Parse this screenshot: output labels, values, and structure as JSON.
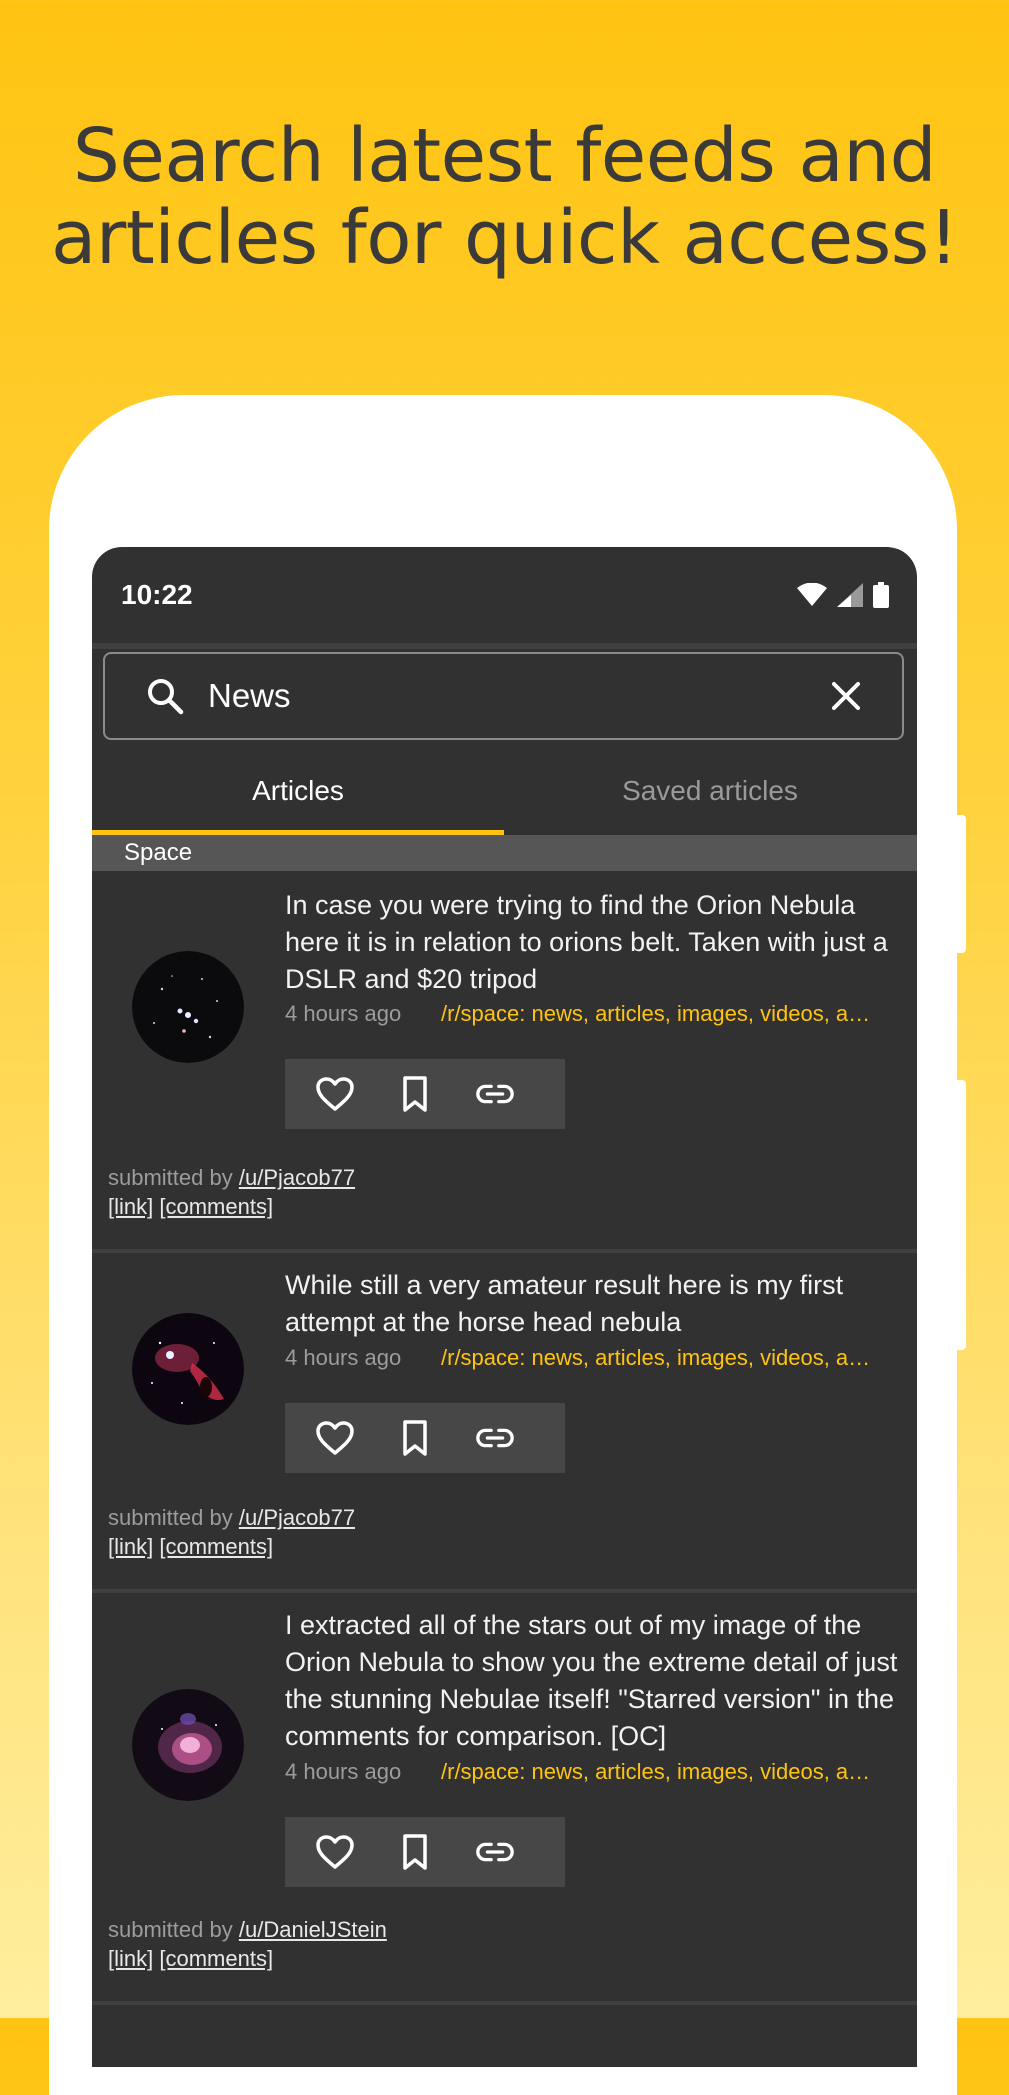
{
  "headline": {
    "line1": "Search latest feeds and",
    "line2": "articles for quick access!"
  },
  "status_bar": {
    "time": "10:22",
    "icons": [
      "wifi-icon",
      "signal-icon",
      "battery-icon"
    ]
  },
  "search": {
    "value": "News",
    "icons": [
      "search-icon",
      "close-icon"
    ]
  },
  "tabs": [
    {
      "label": "Articles",
      "active": true
    },
    {
      "label": "Saved articles",
      "active": false
    }
  ],
  "section": {
    "title": "Space"
  },
  "articles": [
    {
      "title": "In case you were trying to find the Orion Nebula here it is in relation to orions belt. Taken with just a DSLR and $20 tripod",
      "time_ago": "4 hours ago",
      "subreddit": "/r/space: news, articles, images, videos, a…",
      "submitted_prefix": "submitted by",
      "user": "/u/Pjacob77",
      "link_label": "[link]",
      "comments_label": "[comments]",
      "thumbnail": "orion-belt-thumbnail"
    },
    {
      "title": "While still a very amateur result here is my first attempt at the horse head nebula",
      "time_ago": "4 hours ago",
      "subreddit": "/r/space: news, articles, images, videos, a…",
      "submitted_prefix": "submitted by",
      "user": "/u/Pjacob77",
      "link_label": "[link]",
      "comments_label": "[comments]",
      "thumbnail": "horsehead-nebula-thumbnail"
    },
    {
      "title": "I extracted all of the stars out of my image of the Orion Nebula to show you the extreme detail of just the stunning Nebulae itself! \"Starred version\" in the comments for comparison. [OC]",
      "time_ago": "4 hours ago",
      "subreddit": "/r/space: news, articles, images, videos, a…",
      "submitted_prefix": "submitted by",
      "user": "/u/DanielJStein",
      "link_label": "[link]",
      "comments_label": "[comments]",
      "thumbnail": "orion-nebula-thumbnail"
    }
  ],
  "action_icons": [
    "heart-icon",
    "bookmark-icon",
    "link-icon"
  ],
  "colors": {
    "accent": "#FFC412",
    "background_top": "#FFC412",
    "background_bottom": "#FFEE9E",
    "surface": "#313131"
  }
}
